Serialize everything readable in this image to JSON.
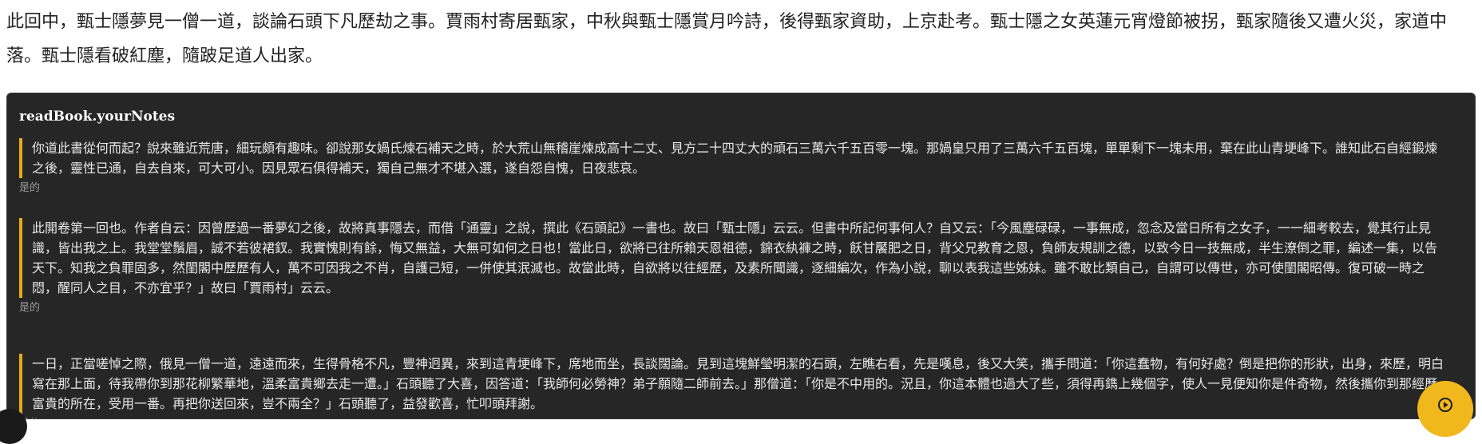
{
  "summary": "此回中，甄士隱夢見一僧一道，談論石頭下凡歷劫之事。賈雨村寄居甄家，中秋與甄士隱賞月吟詩，後得甄家資助，上京赴考。甄士隱之女英蓮元宵燈節被拐，甄家隨後又遭火災，家道中落。甄士隱看破紅塵，隨跛足道人出家。",
  "notes": {
    "title": "readBook.yourNotes",
    "items": [
      {
        "quote": "你道此書從何而起？說來雖近荒唐，細玩頗有趣味。卻說那女媧氏煉石補天之時，於大荒山無稽崖煉成高十二丈、見方二十四丈大的頑石三萬六千五百零一塊。那媧皇只用了三萬六千五百塊，單單剩下一塊未用，棄在此山青埂峰下。誰知此石自經鍛煉之後，靈性已通，自去自來，可大可小。因見眾石俱得補天，獨自己無才不堪入選，遂自怨自愧，日夜悲哀。",
        "comment": "是的"
      },
      {
        "quote": "此開卷第一回也。作者自云：因曾歷過一番夢幻之後，故將真事隱去，而借「通靈」之說，撰此《石頭記》一書也。故曰「甄士隱」云云。但書中所記何事何人？自又云：「今風塵碌碌，一事無成，忽念及當日所有之女子，一一細考較去，覺其行止見識，皆出我之上。我堂堂鬚眉，誠不若彼裙釵。我實愧則有餘，悔又無益，大無可如何之日也！當此日，欲將已往所賴天恩祖德，錦衣紈褲之時，飫甘饜肥之日，背父兄教育之恩，負師友規訓之德，以致今日一技無成，半生潦倒之罪，編述一集，以告天下。知我之負罪固多，然閨閣中歷歷有人，萬不可因我之不肖，自護己短，一併使其泯滅也。故當此時，自欲將以往經歷，及素所聞識，逐細編次，作為小說，聊以表我這些姊妹。雖不敢比類自己，自謂可以傳世，亦可使閨閣昭傳。復可破一時之悶，醒同人之目，不亦宜乎？」故曰「賈雨村」云云。",
        "comment": "是的"
      },
      {
        "quote": "一日，正當嗟悼之際，俄見一僧一道，遠遠而來，生得骨格不凡，豐神迥異，來到這青埂峰下，席地而坐，長談闊論。見到這塊鮮瑩明潔的石頭，左瞧右看，先是嘆息，後又大笑，攜手問道：「你這蠢物，有何好處？倒是把你的形狀，出身，來歷，明白寫在那上面，待我帶你到那花柳繁華地，溫柔富貴鄉去走一遭。」石頭聽了大喜，因答道：「我師何必勞神？弟子願隨二師前去。」那僧道：「你是不中用的。況且，你這本體也過大了些，須得再鐫上幾個字，使人一見便知你是件奇物，然後攜你到那經歷富貴的所在，受用一番。再把你送回來，豈不兩全？」石頭聽了，益發歡喜，忙叩頭拜謝。",
        "comment": "是的"
      }
    ]
  },
  "play_button": {
    "icon": "play-circle-icon",
    "color": "#f0b81d"
  },
  "colors": {
    "panel_background": "#262626",
    "quote_bar": "#e5ac17"
  }
}
